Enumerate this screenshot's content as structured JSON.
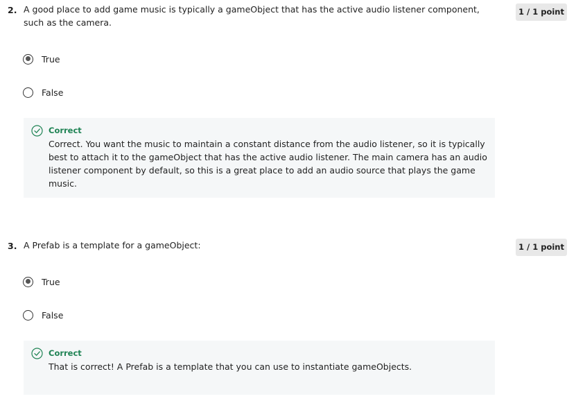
{
  "questions": [
    {
      "number": "2.",
      "text": "A good place to add game music is typically a gameObject that has the active audio listener component, such as the camera.",
      "points": "1 / 1 point",
      "options": [
        {
          "label": "True",
          "selected": true
        },
        {
          "label": "False",
          "selected": false
        }
      ],
      "feedback": {
        "title": "Correct",
        "text": "Correct. You want the music to maintain a constant distance from the audio listener, so it is typically best to attach it to the gameObject that has the active audio listener. The main camera has an audio listener component by default, so this is a great place to add an audio source that plays the game music."
      }
    },
    {
      "number": "3.",
      "text": "A Prefab is a template for a gameObject:",
      "points": "1 / 1 point",
      "options": [
        {
          "label": "True",
          "selected": true
        },
        {
          "label": "False",
          "selected": false
        }
      ],
      "feedback": {
        "title": "Correct",
        "text": "That is correct! A Prefab is a template that you can use to instantiate gameObjects."
      }
    }
  ],
  "colors": {
    "correct": "#1f8354",
    "feedback_bg": "#f5f7f8",
    "badge_bg": "#e8e8e8"
  },
  "icons": {
    "feedback": "check-circle-icon",
    "radio_selected": "radio-selected-icon",
    "radio_unselected": "radio-unselected-icon"
  }
}
